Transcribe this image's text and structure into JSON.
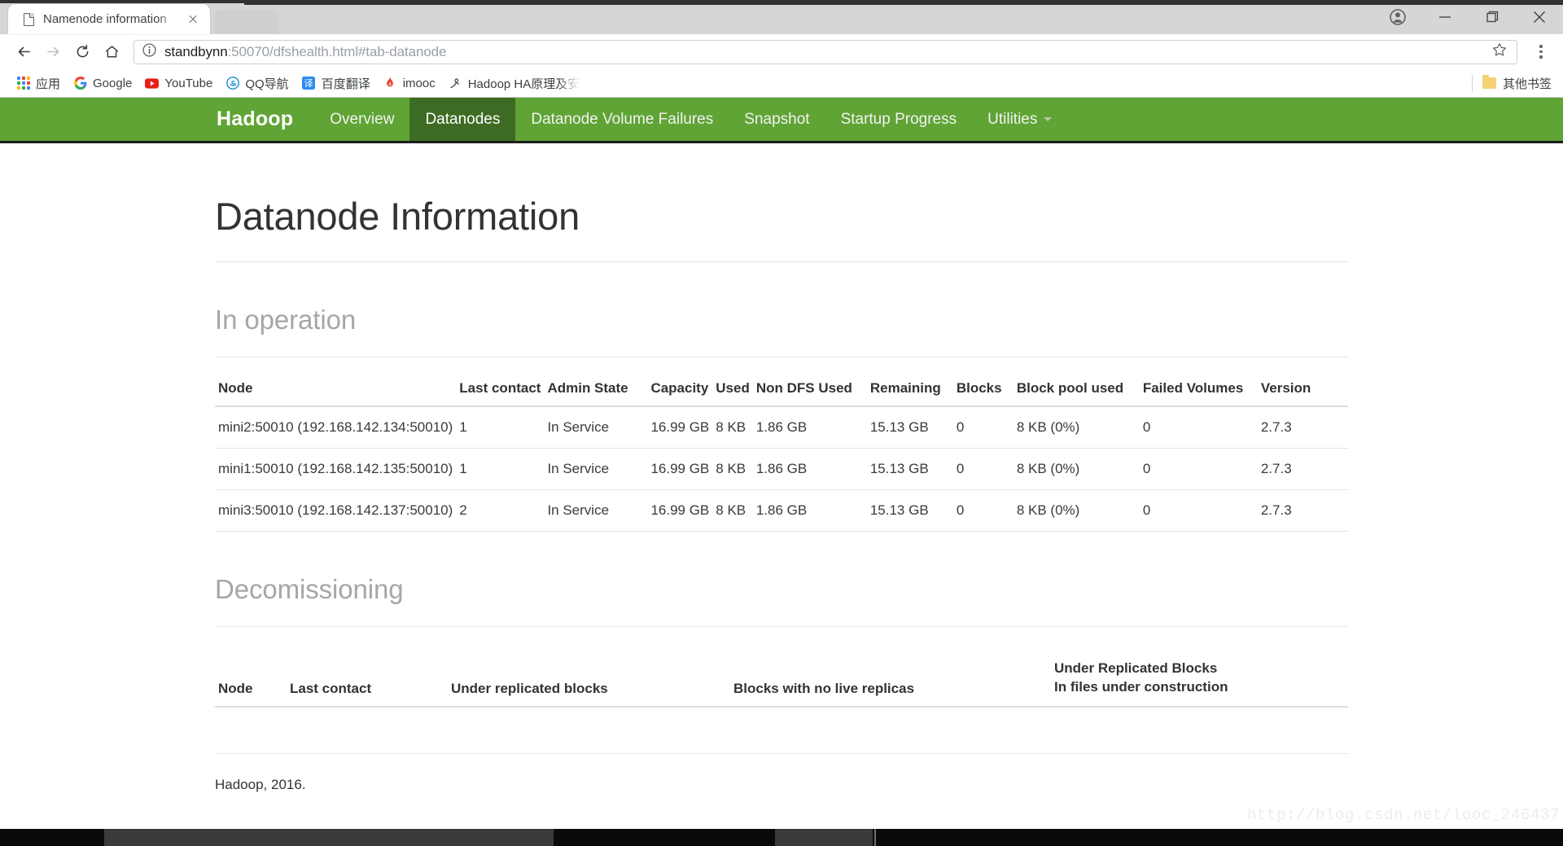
{
  "browser": {
    "tab": {
      "title": "Namenode information",
      "favicon": "page-icon",
      "close": "close-icon"
    },
    "window_controls": {
      "profile": "account-icon",
      "minimize": "minimize-icon",
      "maximize": "maximize-icon",
      "close": "close-icon"
    },
    "toolbar": {
      "back": "back-arrow-icon",
      "forward": "forward-arrow-icon",
      "reload": "reload-icon",
      "home": "home-icon",
      "security_icon": "info-circle-icon",
      "url_host": "standbynn",
      "url_rest": ":50070/dfshealth.html#tab-datanode",
      "url_full": "standbynn:50070/dfshealth.html#tab-datanode",
      "bookmark_star": "star-icon",
      "menu": "three-dots-menu-icon"
    },
    "bookmarks": {
      "items": [
        {
          "label": "应用",
          "icon": "apps-grid-icon"
        },
        {
          "label": "Google",
          "icon": "google-icon"
        },
        {
          "label": "YouTube",
          "icon": "youtube-icon"
        },
        {
          "label": "QQ导航",
          "icon": "ie-browser-icon"
        },
        {
          "label": "百度翻译",
          "icon": "baidu-translate-icon"
        },
        {
          "label": "imooc",
          "icon": "flame-icon"
        },
        {
          "label": "Hadoop HA原理及安",
          "icon": "bookmark-site-icon"
        }
      ],
      "other_bookmarks": {
        "label": "其他书签",
        "icon": "folder-icon"
      }
    }
  },
  "page": {
    "navbar": {
      "brand": "Hadoop",
      "items": [
        {
          "label": "Overview",
          "active": false
        },
        {
          "label": "Datanodes",
          "active": true
        },
        {
          "label": "Datanode Volume Failures",
          "active": false
        },
        {
          "label": "Snapshot",
          "active": false
        },
        {
          "label": "Startup Progress",
          "active": false
        },
        {
          "label": "Utilities",
          "active": false,
          "caret": true
        }
      ],
      "brand_color": "#5fa434",
      "active_color": "#3e6b23"
    },
    "title": "Datanode Information",
    "in_operation": {
      "heading": "In operation",
      "columns": [
        "Node",
        "Last contact",
        "Admin State",
        "Capacity",
        "Used",
        "Non DFS Used",
        "Remaining",
        "Blocks",
        "Block pool used",
        "Failed Volumes",
        "Version"
      ],
      "rows": [
        [
          "mini2:50010 (192.168.142.134:50010)",
          "1",
          "In Service",
          "16.99 GB",
          "8 KB",
          "1.86 GB",
          "15.13 GB",
          "0",
          "8 KB (0%)",
          "0",
          "2.7.3"
        ],
        [
          "mini1:50010 (192.168.142.135:50010)",
          "1",
          "In Service",
          "16.99 GB",
          "8 KB",
          "1.86 GB",
          "15.13 GB",
          "0",
          "8 KB (0%)",
          "0",
          "2.7.3"
        ],
        [
          "mini3:50010 (192.168.142.137:50010)",
          "2",
          "In Service",
          "16.99 GB",
          "8 KB",
          "1.86 GB",
          "15.13 GB",
          "0",
          "8 KB (0%)",
          "0",
          "2.7.3"
        ]
      ]
    },
    "decommissioning": {
      "heading": "Decomissioning",
      "columns": [
        "Node",
        "Last contact",
        "Under replicated blocks",
        "Blocks with no live replicas",
        "Under Replicated Blocks|In files under construction"
      ],
      "rows": []
    },
    "footer": "Hadoop, 2016.",
    "watermark": "http://blog.csdn.net/looc_246437"
  },
  "taskbar": {
    "clock": ""
  }
}
